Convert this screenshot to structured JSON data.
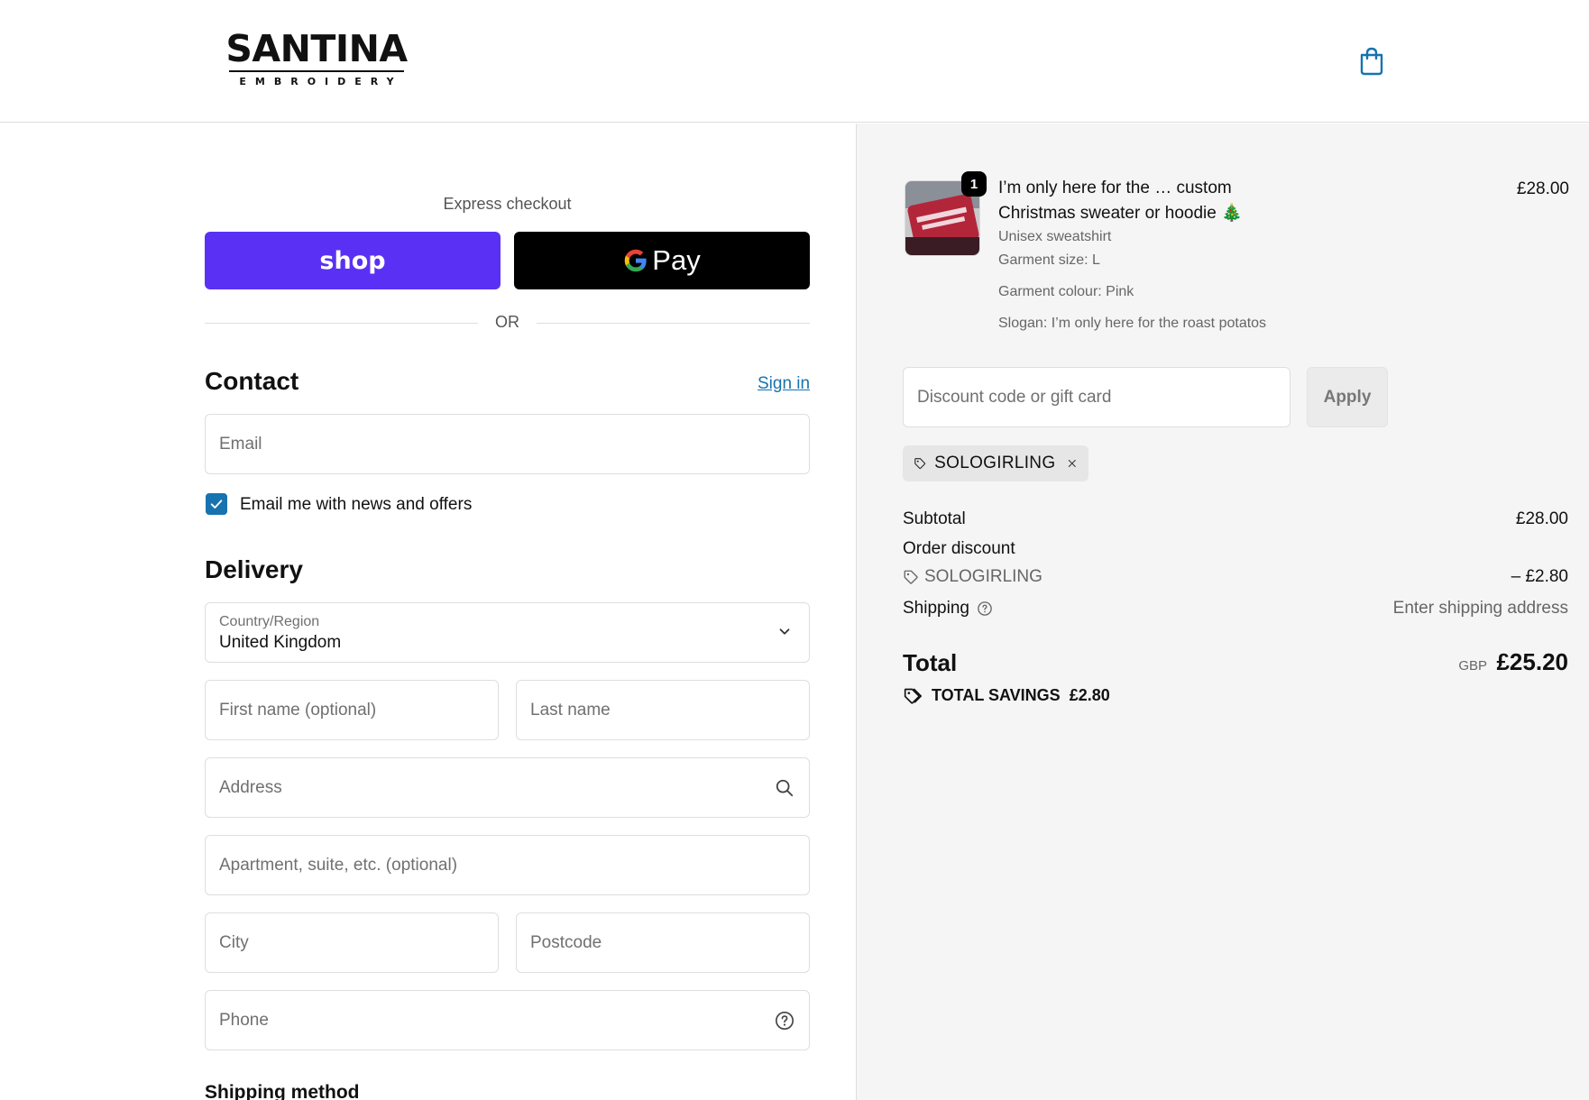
{
  "brand": {
    "name": "SANTINA",
    "tagline": "EMBROIDERY"
  },
  "express": {
    "label": "Express checkout",
    "shop_label": "shop",
    "gpay_label": "Pay",
    "or_label": "OR"
  },
  "contact": {
    "title": "Contact",
    "sign_in": "Sign in",
    "email_placeholder": "Email",
    "newsletter_label": "Email me with news and offers",
    "newsletter_checked": true
  },
  "delivery": {
    "title": "Delivery",
    "country_label": "Country/Region",
    "country_value": "United Kingdom",
    "first_name_placeholder": "First name (optional)",
    "last_name_placeholder": "Last name",
    "address_placeholder": "Address",
    "apartment_placeholder": "Apartment, suite, etc. (optional)",
    "city_placeholder": "City",
    "postcode_placeholder": "Postcode",
    "phone_placeholder": "Phone"
  },
  "shipping_method": {
    "title": "Shipping method"
  },
  "order": {
    "item": {
      "quantity": "1",
      "name": "I’m only here for the … custom Christmas sweater or hoodie 🎄",
      "price": "£28.00",
      "variant": "Unisex sweatshirt",
      "size": "Garment size: L",
      "colour": "Garment colour: Pink",
      "slogan": "Slogan: I’m only here for the roast potatos"
    },
    "discount_placeholder": "Discount code or gift card",
    "apply_label": "Apply",
    "applied_code": "SOLOGIRLING",
    "subtotal_label": "Subtotal",
    "subtotal_value": "£28.00",
    "order_discount_label": "Order discount",
    "discount_code": "SOLOGIRLING",
    "discount_value": "– £2.80",
    "shipping_label": "Shipping",
    "shipping_value": "Enter shipping address",
    "total_label": "Total",
    "total_currency": "GBP",
    "total_value": "£25.20",
    "savings_label": "TOTAL SAVINGS",
    "savings_value": "£2.80"
  },
  "colors": {
    "shop_purple": "#5a31f4",
    "link_blue": "#1773b0",
    "summary_bg": "#f5f5f5"
  }
}
